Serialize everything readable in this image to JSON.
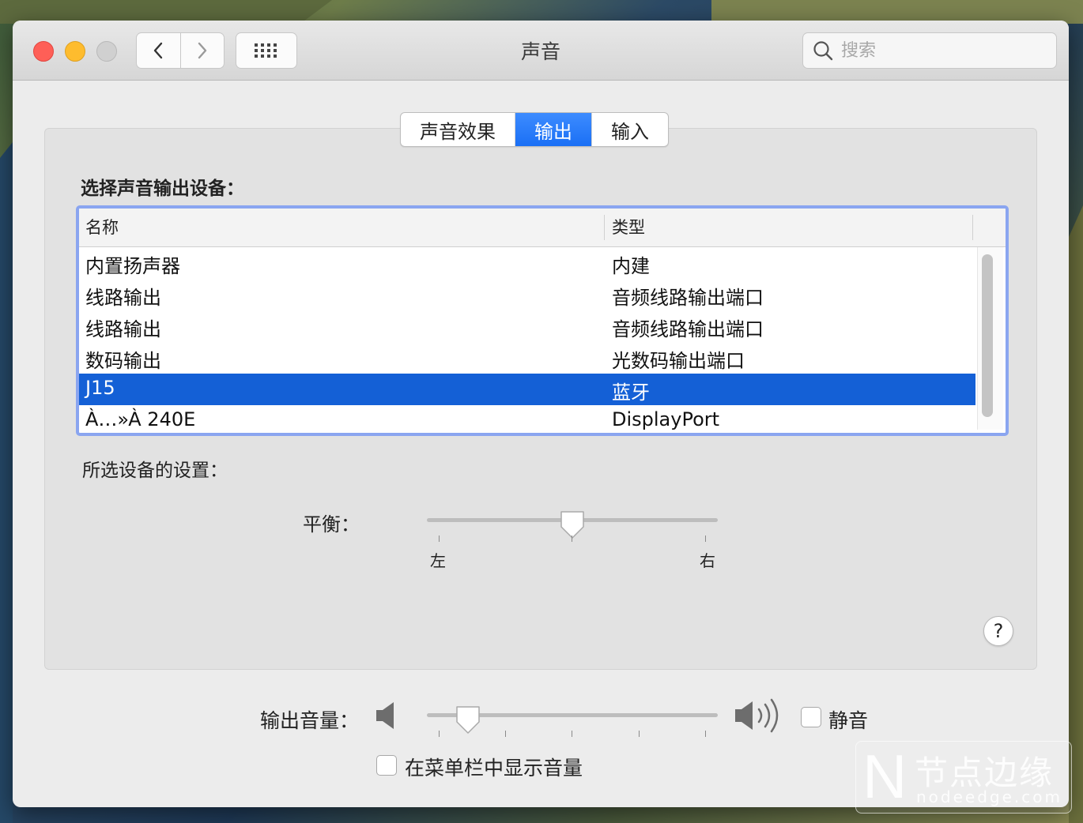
{
  "window": {
    "title": "声音"
  },
  "toolbar": {
    "search_placeholder": "搜索"
  },
  "tabs": [
    {
      "label": "声音效果",
      "active": false
    },
    {
      "label": "输出",
      "active": true
    },
    {
      "label": "输入",
      "active": false
    }
  ],
  "output": {
    "device_heading": "选择声音输出设备：",
    "columns": {
      "name": "名称",
      "type": "类型"
    },
    "devices": [
      {
        "name": "内置扬声器",
        "type": "内建",
        "selected": false
      },
      {
        "name": "线路输出",
        "type": "音频线路输出端口",
        "selected": false
      },
      {
        "name": "线路输出",
        "type": "音频线路输出端口",
        "selected": false
      },
      {
        "name": "数码输出",
        "type": "光数码输出端口",
        "selected": false
      },
      {
        "name": "J15",
        "type": "蓝牙",
        "selected": true
      },
      {
        "name": "À…»À 240E",
        "type": "DisplayPort",
        "selected": false
      }
    ],
    "settings_heading": "所选设备的设置：",
    "balance": {
      "label": "平衡：",
      "left_label": "左",
      "right_label": "右",
      "value": 0.5
    }
  },
  "help_label": "?",
  "volume": {
    "label": "输出音量：",
    "value": 0.14,
    "mute_label": "静音",
    "mute_checked": false
  },
  "menubar": {
    "label": "在菜单栏中显示音量",
    "checked": false
  },
  "watermark": {
    "logo_letter": "N",
    "text": "节点边缘",
    "url": "nodeedge.com"
  },
  "colors": {
    "accent": "#1460d6",
    "tab_active": "#2a7cf8",
    "table_focus": "#8aa5f0"
  }
}
